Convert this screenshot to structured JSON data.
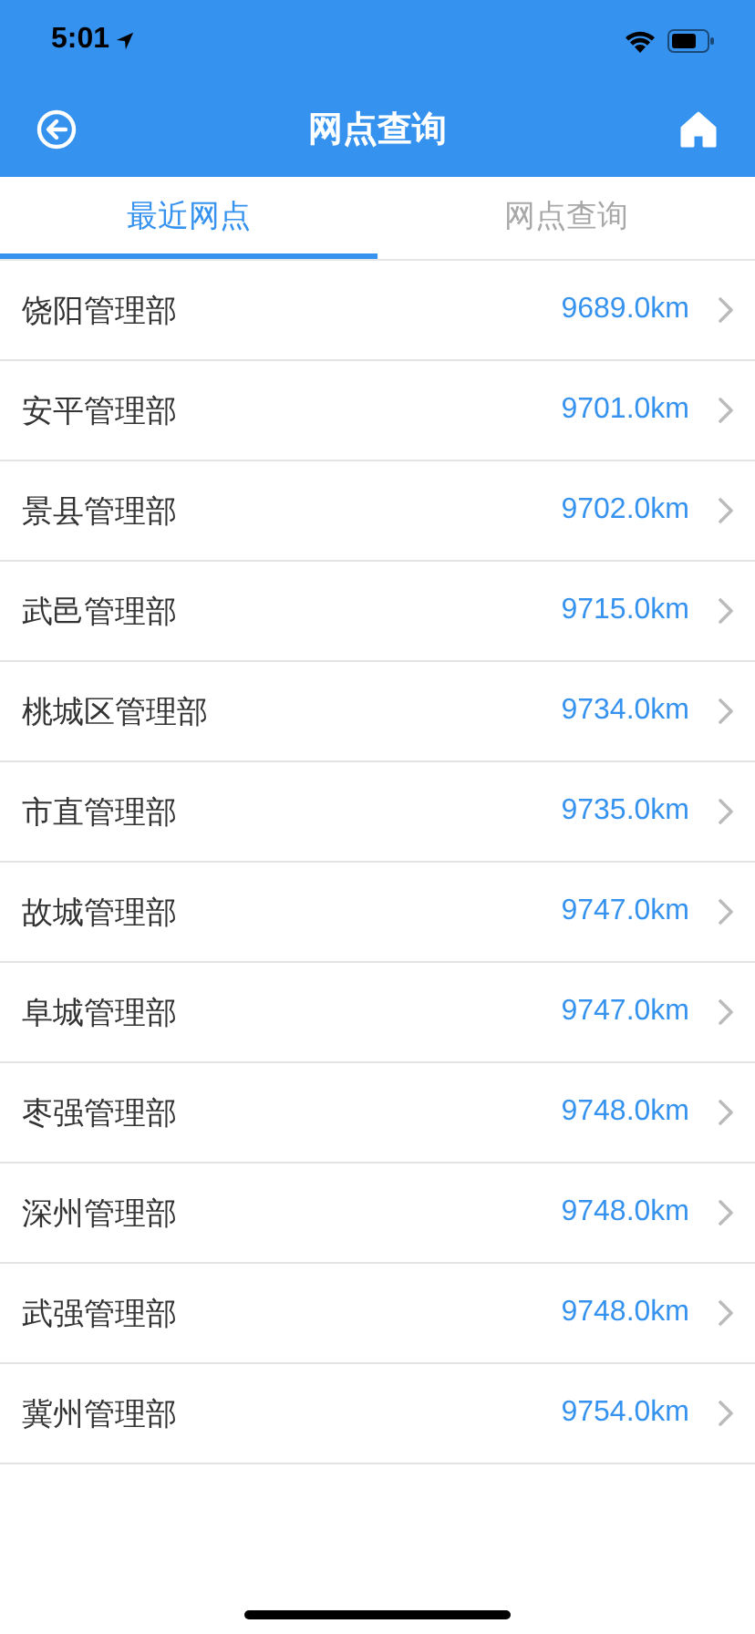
{
  "status_bar": {
    "time": "5:01"
  },
  "nav": {
    "title": "网点查询"
  },
  "tabs": [
    {
      "label": "最近网点",
      "selected": true
    },
    {
      "label": "网点查询",
      "selected": false
    }
  ],
  "branches": [
    {
      "name": "饶阳管理部",
      "distance": "9689.0km"
    },
    {
      "name": "安平管理部",
      "distance": "9701.0km"
    },
    {
      "name": "景县管理部",
      "distance": "9702.0km"
    },
    {
      "name": "武邑管理部",
      "distance": "9715.0km"
    },
    {
      "name": "桃城区管理部",
      "distance": "9734.0km"
    },
    {
      "name": "市直管理部",
      "distance": "9735.0km"
    },
    {
      "name": "故城管理部",
      "distance": "9747.0km"
    },
    {
      "name": "阜城管理部",
      "distance": "9747.0km"
    },
    {
      "name": "枣强管理部",
      "distance": "9748.0km"
    },
    {
      "name": "深州管理部",
      "distance": "9748.0km"
    },
    {
      "name": "武强管理部",
      "distance": "9748.0km"
    },
    {
      "name": "冀州管理部",
      "distance": "9754.0km"
    }
  ]
}
